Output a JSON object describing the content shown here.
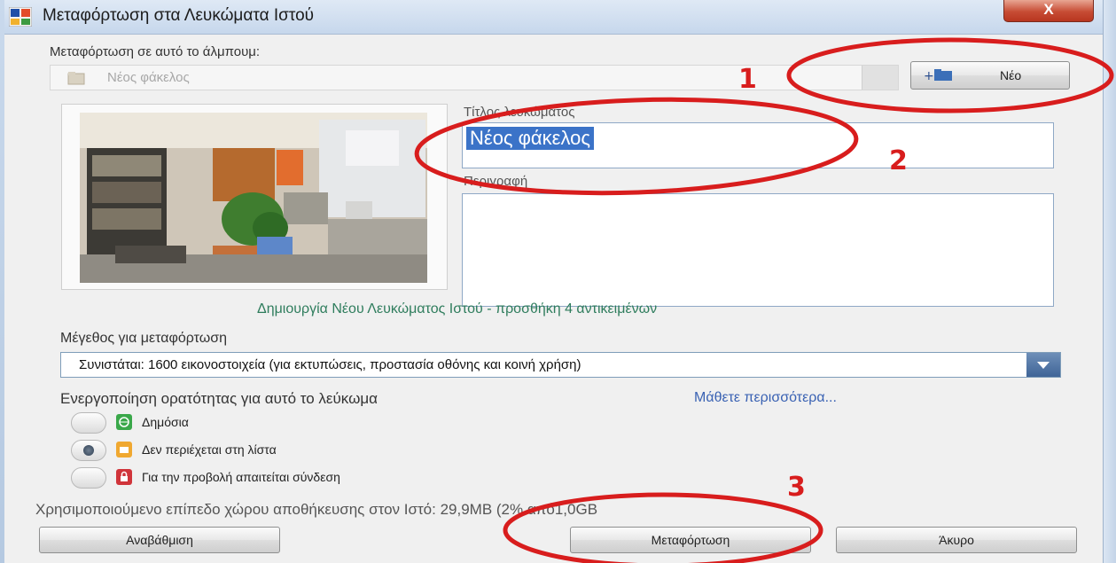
{
  "window": {
    "title": "Μεταφόρτωση στα Λευκώματα Ιστού",
    "close_label": "X"
  },
  "album_select": {
    "label": "Μεταφόρτωση σε αυτό το άλμπουμ:",
    "value": "Νέος φάκελος",
    "new_button_label": "Νέο"
  },
  "album_details": {
    "title_label": "Τίτλος λευκώματος",
    "title_value": "Νέος φάκελος",
    "description_label": "Περιγραφή",
    "description_value": "",
    "status_text": "Δημιουργία Νέου Λευκώματος Ιστού - προσθήκη 4 αντικειμένων"
  },
  "upload_size": {
    "label": "Μέγεθος για μεταφόρτωση",
    "selected": "Συνιστάται: 1600 εικονοστοιχεία (για εκτυπώσεις, προστασία οθόνης και κοινή χρήση)"
  },
  "visibility": {
    "label": "Ενεργοποίηση ορατότητας για αυτό το λεύκωμα",
    "learn_more": "Μάθετε περισσότερα...",
    "options": [
      {
        "label": "Δημόσια",
        "selected": false,
        "icon": "globe-icon",
        "color": "#3aa84a"
      },
      {
        "label": "Δεν περιέχεται στη λίστα",
        "selected": true,
        "icon": "unlisted-icon",
        "color": "#f0a830"
      },
      {
        "label": "Για την προβολή απαιτείται σύνδεση",
        "selected": false,
        "icon": "lock-icon",
        "color": "#d0343a"
      }
    ]
  },
  "storage": {
    "text": "Χρησιμοποιούμενο επίπεδο χώρου αποθήκευσης στον Ιστό: 29,9MB (2% από1,0GB"
  },
  "buttons": {
    "upgrade": "Αναβάθμιση",
    "upload": "Μεταφόρτωση",
    "cancel": "Άκυρο"
  },
  "annotations": {
    "step1": "1",
    "step2": "2",
    "step3": "3",
    "color": "#d81d1d"
  }
}
